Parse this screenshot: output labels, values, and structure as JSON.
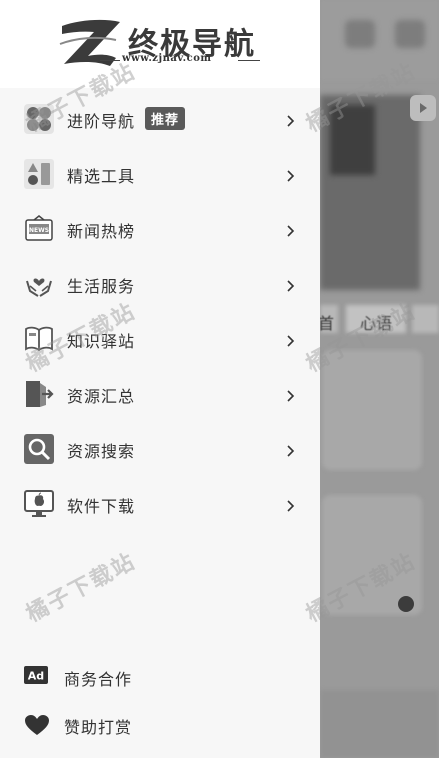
{
  "logo": {
    "brand": "终极导航",
    "url": "www.zjnav.com"
  },
  "menu": [
    {
      "label": "进阶导航",
      "icon": "nodes-icon",
      "badge": "推荐"
    },
    {
      "label": "精选工具",
      "icon": "tools-icon"
    },
    {
      "label": "新闻热榜",
      "icon": "news-icon"
    },
    {
      "label": "生活服务",
      "icon": "heart-hands-icon"
    },
    {
      "label": "知识驿站",
      "icon": "book-icon"
    },
    {
      "label": "资源汇总",
      "icon": "export-icon"
    },
    {
      "label": "资源搜索",
      "icon": "search-icon"
    },
    {
      "label": "软件下载",
      "icon": "apple-monitor-icon"
    }
  ],
  "bottom": [
    {
      "label": "商务合作",
      "icon": "ad-icon",
      "icon_text": "Ad"
    },
    {
      "label": "赞助打赏",
      "icon": "heart-icon"
    }
  ],
  "background": {
    "tab_a": "首",
    "tab_b": "心语"
  },
  "watermark": "橘子下载站",
  "colors": {
    "drawer_bg": "#f7f7f7",
    "badge_bg": "#5a5a5a",
    "text": "#333333"
  }
}
